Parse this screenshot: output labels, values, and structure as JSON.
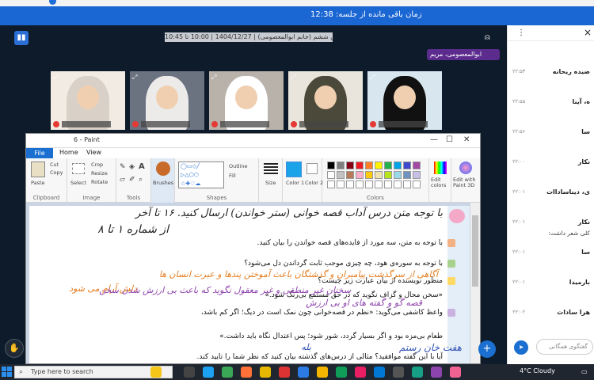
{
  "timer": {
    "label": "زمان باقی مانده از جلسه: 12:38"
  },
  "meeting": {
    "title": "کلاس ششم (خانم ابوالمعصومی) | 1404/12/27 | 10:00 تا 10:45",
    "presenter_chip": "ابوالمعصومی، مریم",
    "logo_icon": "bars-logo-icon",
    "tiles": [
      {
        "scarf": "#d9d1c8",
        "bg": "#f1ebe3"
      },
      {
        "scarf": "#ecebe9",
        "bg": "#6b7280"
      },
      {
        "scarf": "#ffffff",
        "bg": "#b8b2aa"
      },
      {
        "scarf": "#4b4a3a",
        "bg": "#e9e5dc"
      },
      {
        "scarf": "#111111",
        "bg": "#d7e6ef"
      }
    ]
  },
  "paint": {
    "title": "6 - Paint",
    "menu": {
      "file": "File",
      "home": "Home",
      "view": "View"
    },
    "ribbon": {
      "paste": "Paste",
      "cut": "Cut",
      "copy": "Copy",
      "clipboard": "Clipboard",
      "crop": "Crop",
      "resize": "Resize",
      "select": "Select",
      "rotate": "Rotate",
      "image": "Image",
      "tools": "Tools",
      "brushes": "Brushes",
      "outline": "Outline",
      "fill": "Fill",
      "shapes": "Shapes",
      "size": "Size",
      "color1": "Color 1",
      "color2": "Color 2",
      "edit_colors": "Edit colors",
      "edit_with_paint3d": "Edit with Paint 3D",
      "colors": "Colors"
    },
    "palette": [
      "#000000",
      "#7f7f7f",
      "#880015",
      "#ed1c24",
      "#ff7f27",
      "#fff200",
      "#22b14c",
      "#00a2e8",
      "#3f48cc",
      "#a349a4",
      "#ffffff",
      "#c3c3c3",
      "#b97a57",
      "#ffaec9",
      "#ffc90e",
      "#efe4b0",
      "#b5e61d",
      "#99d9ea",
      "#7092be",
      "#c8bfe7"
    ],
    "document": {
      "heading_hand": "با توجه متن درس آداب قصه خوانی (ستر خواندن) ارسال کنید. ۱۶ تا آخر",
      "hand_range": "از شماره ۱ تا ۸",
      "lines": [
        "با توجه به متن، سه مورد از فایده‌های قصه خواندن را بیان کنید.",
        "با توجه به سوره‌ی هود، چه چیزی موجب ثابت گرداندن دل می‌شود؟",
        "منظور نویسنده از بیان عبارت زیر چیست؟",
        "«سخن محال و گزاف نگوید که در حق مستمع بی‌رنگ شود.»",
        "واعظ کاشفی می‌گوید: «نظم در قصه‌خوانی چون نمک است در دیگ؛ اگر کم باشد،",
        "طعام بی‌مزه بود و اگر بسیار گردد، شور شود؛ پس اعتدال نگاه باید داشت.»",
        "آیا با این گفته موافقید؟ مثالی از درس‌های گذشته بیان کنید که نظر شما را تایید کند."
      ],
      "hand_answers": [
        "آگاهی از سرگذشت پیامبران و گذشتگان باعث آموختن پندها و عبرت انسان ها",
        "دلش آرام می شود",
        "سخنان غیر منطقی و غیر معقول نگوید که باعث بی ارزش شدن سخن",
        "قصه گو و گفته های او بی ارزش",
        "بله",
        "هفت خان رستم"
      ]
    }
  },
  "chat": {
    "items": [
      {
        "name": "ضیده ریحانه",
        "time": "۲۲:۵۳",
        "msg": ""
      },
      {
        "name": "ه، آینا",
        "time": "۲۲:۵۵",
        "msg": ""
      },
      {
        "name": "سا",
        "time": "۲۲:۵۶",
        "msg": ""
      },
      {
        "name": "نکار",
        "time": "۲۲:۰۰",
        "msg": ""
      },
      {
        "name": "ی، دیناساداات",
        "time": "۲۲:۰۱",
        "msg": ""
      },
      {
        "name": "نکار",
        "time": "۲۲:۰۱",
        "msg": "کلی شعر داشت:"
      },
      {
        "name": "سا",
        "time": "۲۲:۰۱",
        "msg": ""
      },
      {
        "name": "بارمیدا",
        "time": "۲۲:۰۱",
        "msg": ""
      },
      {
        "name": "هرا سادات",
        "time": "۲۲:۰۲",
        "msg": ""
      }
    ],
    "input_placeholder": "گفتگوی همگانی",
    "send_icon": "send-arrow-icon"
  },
  "taskbar": {
    "search_placeholder": "Type here to search",
    "weather": "4°C  Cloudy"
  }
}
